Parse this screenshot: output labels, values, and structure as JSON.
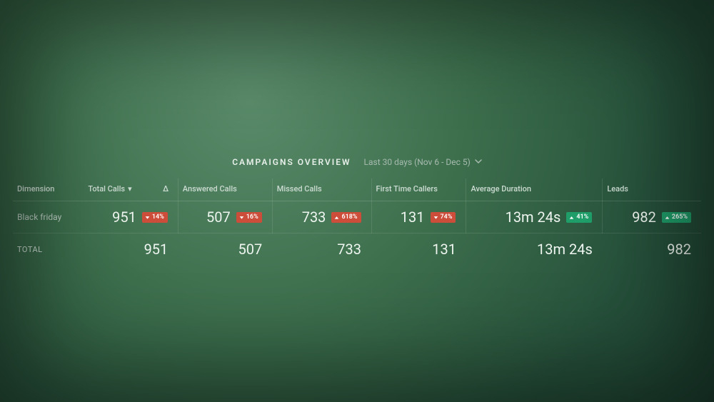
{
  "header": {
    "title": "CAMPAIGNS OVERVIEW",
    "range_label": "Last 30 days (Nov 6 - Dec 5)"
  },
  "columns": {
    "dimension": "Dimension",
    "total_calls": "Total Calls",
    "delta_symbol": "Δ",
    "answered_calls": "Answered Calls",
    "missed_calls": "Missed Calls",
    "first_time_callers": "First Time Callers",
    "avg_duration": "Average Duration",
    "leads": "Leads"
  },
  "rows": [
    {
      "dimension": "Black friday",
      "total_calls": {
        "value": "951",
        "delta": "14%",
        "dir": "down"
      },
      "answered_calls": {
        "value": "507",
        "delta": "16%",
        "dir": "down"
      },
      "missed_calls": {
        "value": "733",
        "delta": "618%",
        "dir": "up_bad"
      },
      "first_time_callers": {
        "value": "131",
        "delta": "74%",
        "dir": "down"
      },
      "avg_duration": {
        "value": "13m 24s",
        "delta": "41%",
        "dir": "up_good"
      },
      "leads": {
        "value": "982",
        "delta": "265%",
        "dir": "up_good"
      }
    }
  ],
  "totals": {
    "label": "TOTAL",
    "total_calls": "951",
    "answered_calls": "507",
    "missed_calls": "733",
    "first_time_callers": "131",
    "avg_duration": "13m 24s",
    "leads": "982"
  },
  "colors": {
    "badge_down": "#cc4d3a",
    "badge_up": "#1f9e6a"
  }
}
